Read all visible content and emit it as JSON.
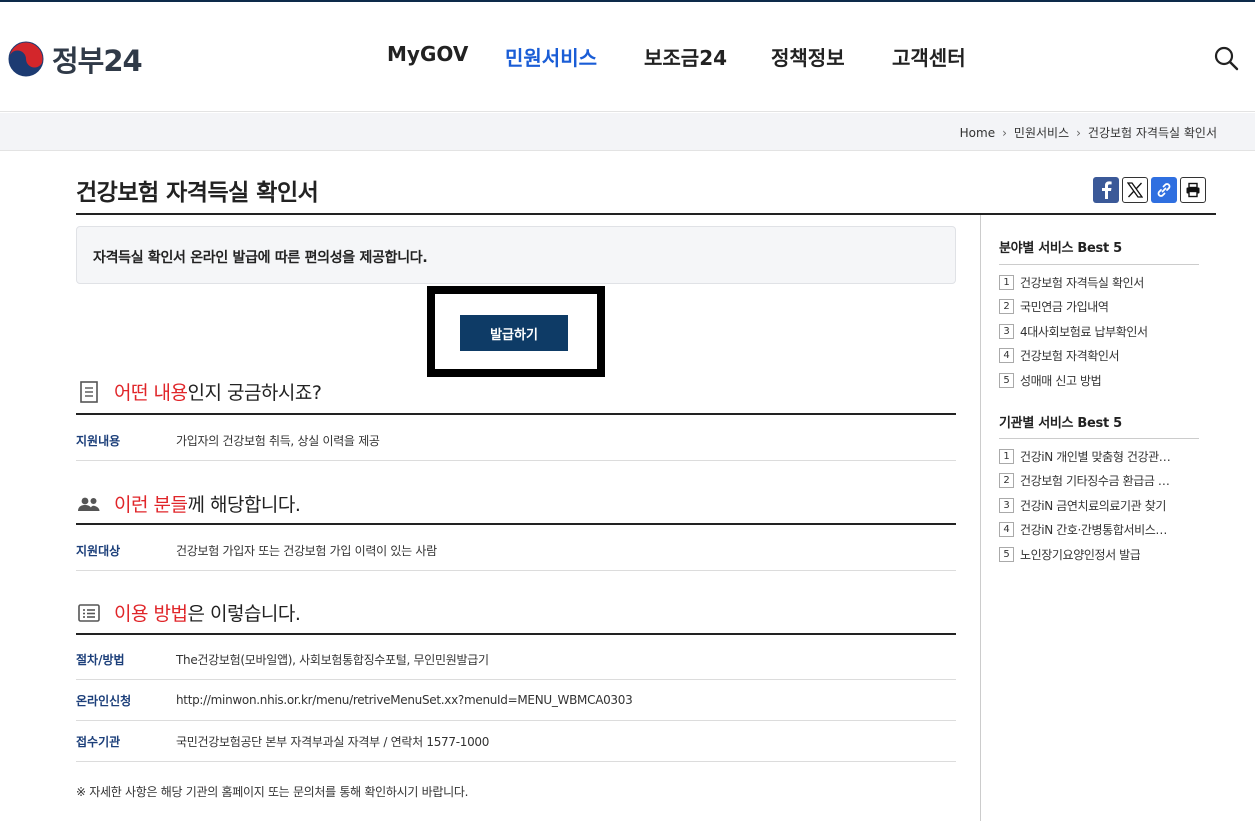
{
  "header": {
    "logo_text": "정부24",
    "nav": [
      "MyGOV",
      "민원서비스",
      "보조금24",
      "정책정보",
      "고객센터"
    ]
  },
  "breadcrumb": [
    "Home",
    "민원서비스",
    "건강보험 자격득실 확인서"
  ],
  "page": {
    "title": "건강보험 자격득실 확인서",
    "notice": "자격득실 확인서 온라인 발급에 따른 편의성을 제공합니다.",
    "issue_button": "발급하기"
  },
  "sections": [
    {
      "highlight": "어떤 내용",
      "rest": "인지 궁금하시죠?",
      "rows": [
        {
          "key": "지원내용",
          "value": "가입자의 건강보험 취득, 상실 이력을 제공"
        }
      ]
    },
    {
      "highlight": "이런 분들",
      "rest": "께 해당합니다.",
      "rows": [
        {
          "key": "지원대상",
          "value": "건강보험 가입자 또는 건강보험 가입 이력이 있는 사람"
        }
      ]
    },
    {
      "highlight": "이용 방법",
      "rest": "은 이렇습니다.",
      "rows": [
        {
          "key": "절차/방법",
          "value": "The건강보험(모바일앱), 사회보험통합징수포털, 무인민원발급기"
        },
        {
          "key": "온라인신청",
          "value": "http://minwon.nhis.or.kr/menu/retriveMenuSet.xx?menuId=MENU_WBMCA0303"
        },
        {
          "key": "접수기관",
          "value": "국민건강보험공단 본부 자격부과실 자격부 / 연락처 1577-1000"
        }
      ]
    }
  ],
  "footnote": "※ 자세한 사항은 해당 기관의 홈페이지 또는 문의처를 통해 확인하시기 바랍니다.",
  "sidebar": {
    "field_best": {
      "title": "분야별 서비스 Best 5",
      "items": [
        "건강보험 자격득실 확인서",
        "국민연금 가입내역",
        "4대사회보험료 납부확인서",
        "건강보험 자격확인서",
        "성매매 신고 방법"
      ]
    },
    "agency_best": {
      "title": "기관별 서비스 Best 5",
      "items": [
        "건강iN 개인별 맞춤형 건강관…",
        "건강보험 기타징수금 환급금 …",
        "건강iN 금연치료의료기관 찾기",
        "건강iN 간호·간병통합서비스…",
        "노인장기요양인정서 발급"
      ]
    }
  },
  "colors": {
    "accent": "#1a5dd6",
    "highlight": "#e0262a",
    "button": "#0e3b66"
  }
}
